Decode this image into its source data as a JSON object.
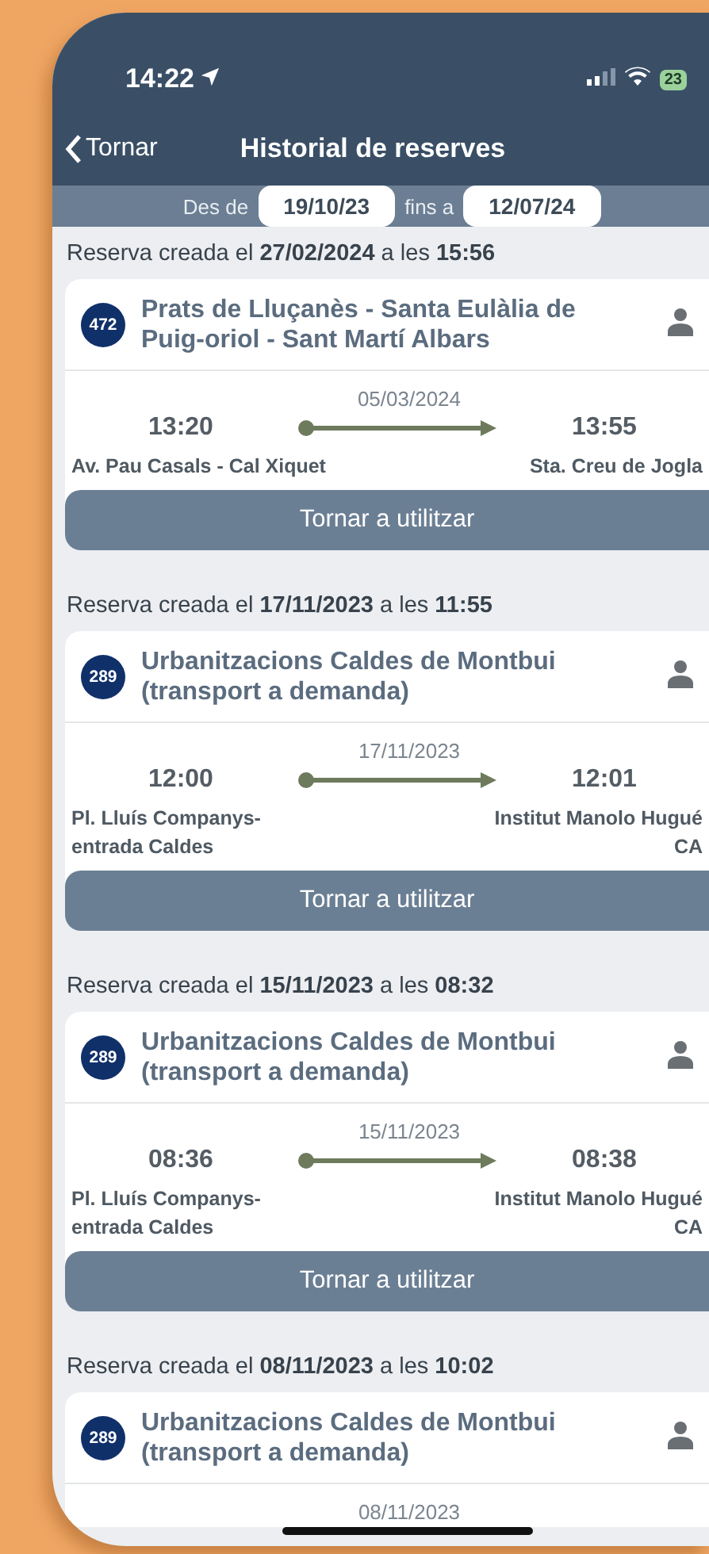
{
  "status_bar": {
    "time": "14:22",
    "battery": "23"
  },
  "nav": {
    "back": "Tornar",
    "title": "Historial de reserves"
  },
  "filter": {
    "from_label": "Des de",
    "from": "19/10/23",
    "to_label": "fins a",
    "to": "12/07/24"
  },
  "reservations": [
    {
      "created": "Reserva creada el **27/02/2024** a les **15:56**",
      "line": "472",
      "route": "Prats de Lluçanès - Santa Eulàlia de Puig-oriol - Sant Martí Albars",
      "date": "05/03/2024",
      "departure_time": "13:20",
      "arrival_time": "13:55",
      "origin": "Av. Pau Casals - Cal Xiquet",
      "destination": "Sta. Creu de Jogla",
      "action": "Tornar a utilitzar"
    },
    {
      "created": "Reserva creada el **17/11/2023** a les **11:55**",
      "line": "289",
      "route": "Urbanitzacions Caldes de Montbui (transport a demanda)",
      "date": "17/11/2023",
      "departure_time": "12:00",
      "arrival_time": "12:01",
      "origin": "Pl. Lluís Companys-\nentrada Caldes",
      "destination": "Institut Manolo Hugué\nCA",
      "action": "Tornar a utilitzar"
    },
    {
      "created": "Reserva creada el **15/11/2023** a les **08:32**",
      "line": "289",
      "route": "Urbanitzacions Caldes de Montbui (transport a demanda)",
      "date": "15/11/2023",
      "departure_time": "08:36",
      "arrival_time": "08:38",
      "origin": "Pl. Lluís Companys-\nentrada Caldes",
      "destination": "Institut Manolo Hugué\nCA",
      "action": "Tornar a utilitzar"
    },
    {
      "created": "Reserva creada el **08/11/2023** a les **10:02**",
      "line": "289",
      "route": "Urbanitzacions Caldes de Montbui (transport a demanda)",
      "date": "08/11/2023"
    }
  ]
}
